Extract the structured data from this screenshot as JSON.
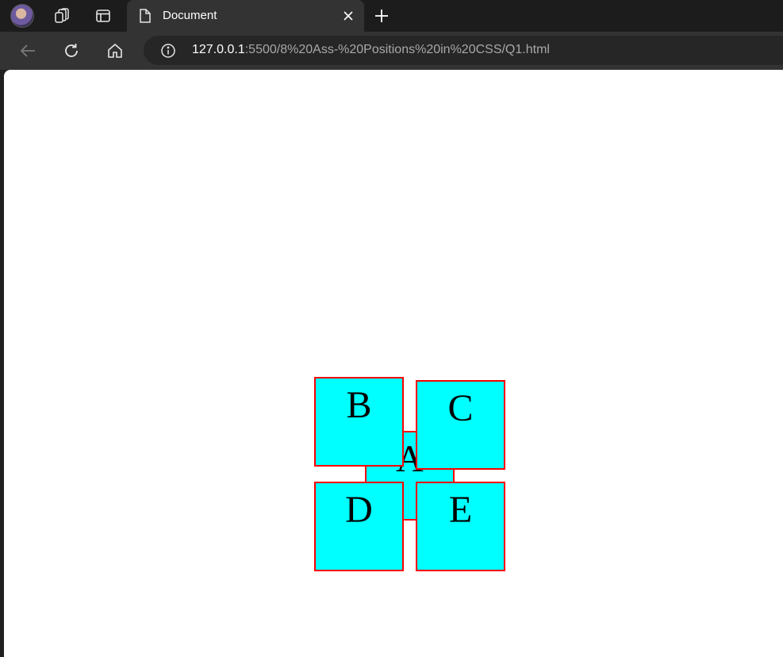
{
  "browser": {
    "tab": {
      "title": "Document"
    },
    "address": {
      "host": "127.0.0.1",
      "rest": ":5500/8%20Ass-%20Positions%20in%20CSS/Q1.html"
    }
  },
  "page": {
    "boxes": {
      "a": "A",
      "b": "B",
      "c": "C",
      "d": "D",
      "e": "E"
    },
    "colors": {
      "box_fill": "#00ffff",
      "box_border": "#ff0000"
    }
  }
}
